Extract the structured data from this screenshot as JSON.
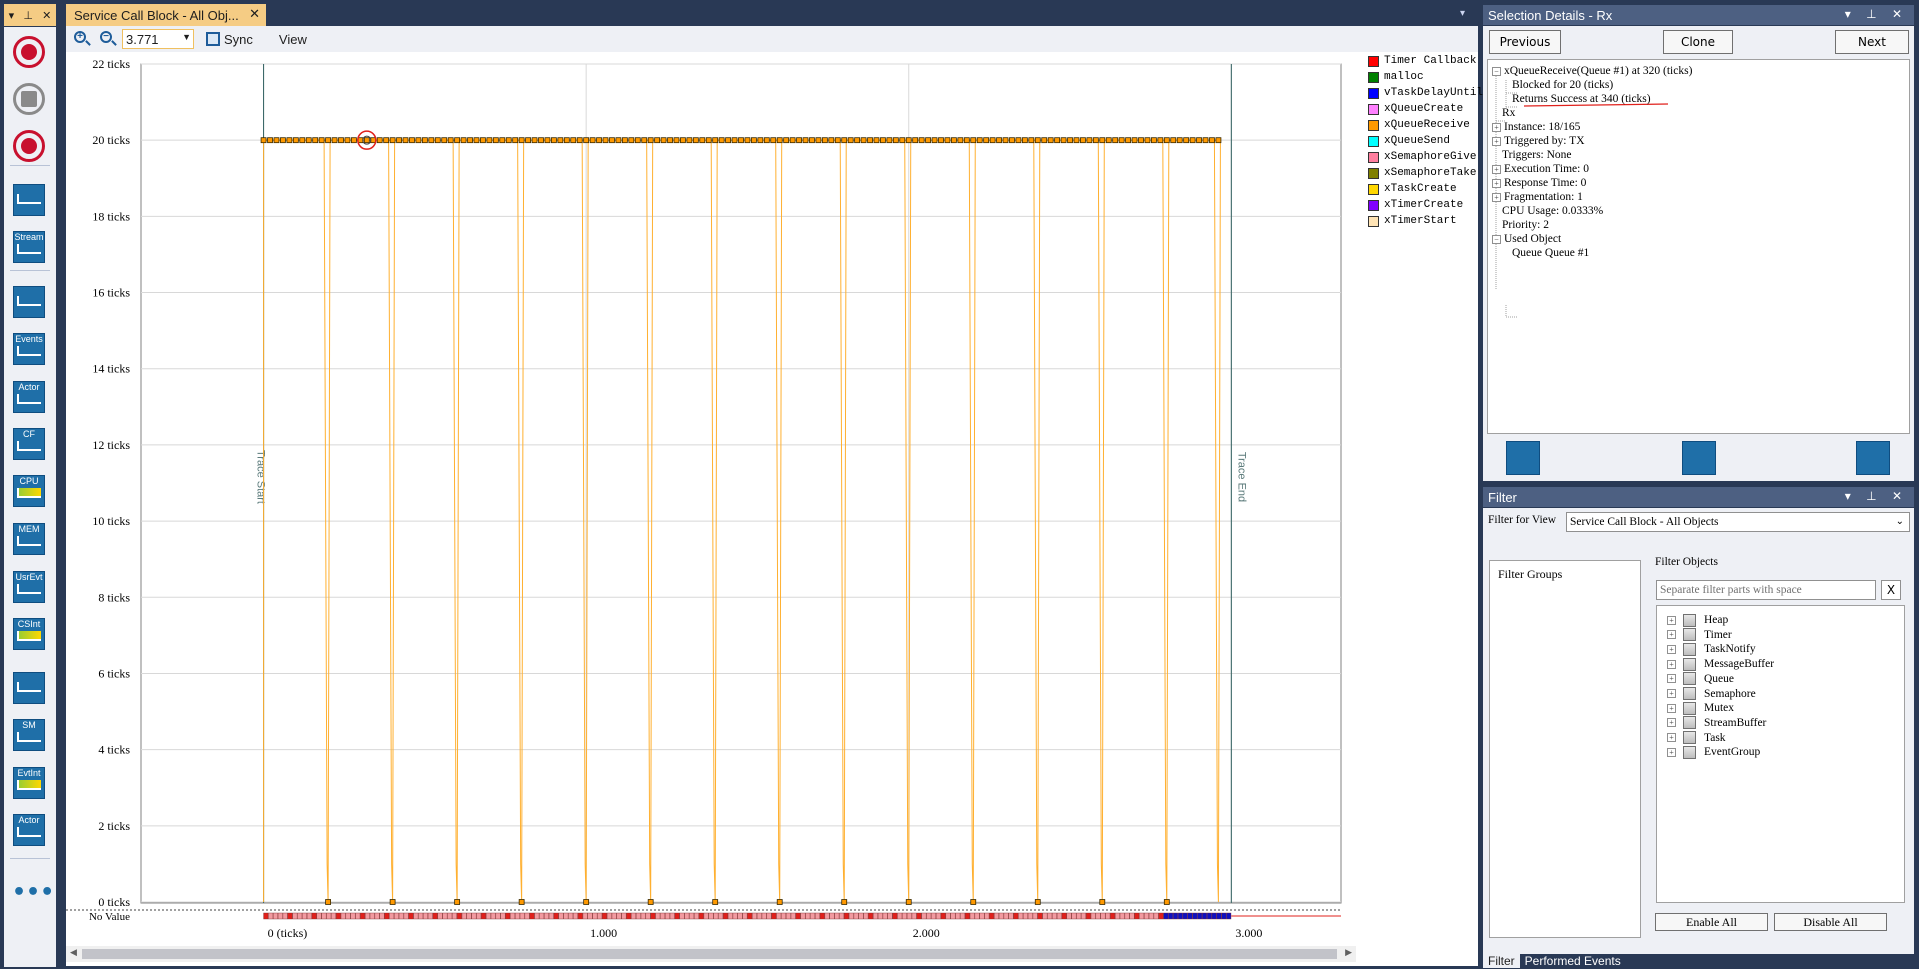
{
  "left_toolbar": {
    "header": [
      "▾",
      "⊥",
      "✕"
    ],
    "tiles": [
      {
        "label": "",
        "icon": "record-icon",
        "color": "#c8102e"
      },
      {
        "label": "",
        "icon": "stop-icon",
        "color": "#8a8a8a"
      },
      {
        "label": "",
        "icon": "snapshot-icon",
        "color": "#c8102e"
      },
      {
        "label": "",
        "icon": "dashboard-icon",
        "color": "#1f6fa8"
      },
      {
        "label": "Stream",
        "icon": "stream-icon",
        "color": "#1f6fa8"
      },
      {
        "label": "",
        "icon": "trace-view-icon",
        "color": "#1f6fa8"
      },
      {
        "label": "Events",
        "icon": "events-icon",
        "color": "#1f6fa8"
      },
      {
        "label": "Actor",
        "icon": "actor-icon",
        "color": "#1f6fa8"
      },
      {
        "label": "CF",
        "icon": "communication-flow-icon",
        "color": "#1f6fa8"
      },
      {
        "label": "CPU",
        "icon": "cpu-load-icon",
        "color": "#1f6fa8"
      },
      {
        "label": "MEM",
        "icon": "memory-icon",
        "color": "#1f6fa8"
      },
      {
        "label": "UsrEvt",
        "icon": "user-events-icon",
        "color": "#1f6fa8"
      },
      {
        "label": "CSInt",
        "icon": "context-switch-intensity-icon",
        "color": "#1f6fa8"
      },
      {
        "label": "",
        "icon": "object-history-icon",
        "color": "#1f6fa8"
      },
      {
        "label": "SM",
        "icon": "state-machine-icon",
        "color": "#1f6fa8"
      },
      {
        "label": "EvtInt",
        "icon": "event-intensity-icon",
        "color": "#1f6fa8"
      },
      {
        "label": "Actor",
        "icon": "actor-instances-icon",
        "color": "#1f6fa8"
      }
    ],
    "more": "•••"
  },
  "document": {
    "tab_title": "Service Call Block - All Obj...",
    "tab_close": "✕",
    "dropdown": "▾",
    "toolbar": {
      "zoom_value": "3.771",
      "sync_label": "Sync",
      "view_label": "View"
    }
  },
  "chart_data": {
    "type": "scatter",
    "y_ticks": [
      "22 ticks",
      "20 ticks",
      "18 ticks",
      "16 ticks",
      "14 ticks",
      "12 ticks",
      "10 ticks",
      "8 ticks",
      "6 ticks",
      "4 ticks",
      "2 ticks",
      "0 ticks"
    ],
    "y_extra_label": "No Value",
    "x_ticks": [
      "0 (ticks)",
      "1.000",
      "2.000",
      "3.000"
    ],
    "ylim": [
      0,
      22
    ],
    "xlim": [
      -380,
      3340
    ],
    "trace_start_label": "Trace Start",
    "trace_end_label": "Trace End",
    "trace_start": 0,
    "trace_end": 3000,
    "series": [
      {
        "name": "xQueueReceive",
        "color": "#ff9900",
        "y": 20,
        "x_from": 0,
        "x_to": 2960,
        "step": 20
      },
      {
        "name": "xQueueSend",
        "color": "#ff9900",
        "y": 0,
        "x": [
          200,
          400,
          600,
          800,
          1000,
          1200,
          1400,
          1600,
          1800,
          2000,
          2200,
          2400,
          2600,
          2800
        ]
      }
    ],
    "drop_lines_x": [
      0,
      200,
      400,
      600,
      800,
      1000,
      1200,
      1400,
      1600,
      1800,
      2000,
      2200,
      2400,
      2600,
      2800,
      2960
    ],
    "highlight_x": 320,
    "grid": true
  },
  "legend": [
    {
      "name": "Timer Callback",
      "color": "#ff0000"
    },
    {
      "name": "malloc",
      "color": "#008000"
    },
    {
      "name": "vTaskDelayUntil",
      "color": "#0000ff"
    },
    {
      "name": "xQueueCreate",
      "color": "#ff80ff"
    },
    {
      "name": "xQueueReceive",
      "color": "#ff9900"
    },
    {
      "name": "xQueueSend",
      "color": "#00ffff"
    },
    {
      "name": "xSemaphoreGive",
      "color": "#ff7f9f"
    },
    {
      "name": "xSemaphoreTake",
      "color": "#808000"
    },
    {
      "name": "xTaskCreate",
      "color": "#ffd700"
    },
    {
      "name": "xTimerCreate",
      "color": "#8000ff"
    },
    {
      "name": "xTimerStart",
      "color": "#ffe4b5"
    }
  ],
  "selection_details": {
    "title": "Selection Details - Rx",
    "controls": "▾ ⊥ ✕",
    "previous": "Previous",
    "clone": "Clone",
    "next": "Next",
    "tree": [
      {
        "text": "xQueueReceive(Queue #1) at 320 (ticks)",
        "indent": 0,
        "expander": "−"
      },
      {
        "text": "Blocked for 20 (ticks)",
        "indent": 2,
        "expander": ""
      },
      {
        "text": "Returns Success at 340 (ticks)",
        "indent": 2,
        "expander": ""
      },
      {
        "text": "Rx",
        "indent": 1,
        "expander": ""
      },
      {
        "text": "Instance: 18/165",
        "indent": 0,
        "expander": "+"
      },
      {
        "text": "Triggered by: TX",
        "indent": 0,
        "expander": "+"
      },
      {
        "text": "Triggers: None",
        "indent": 1,
        "expander": ""
      },
      {
        "text": "Execution Time: 0",
        "indent": 0,
        "expander": "+"
      },
      {
        "text": "Response Time: 0",
        "indent": 0,
        "expander": "+"
      },
      {
        "text": "Fragmentation: 1",
        "indent": 0,
        "expander": "+"
      },
      {
        "text": "CPU Usage: 0.0333%",
        "indent": 1,
        "expander": ""
      },
      {
        "text": "Priority: 2",
        "indent": 1,
        "expander": ""
      },
      {
        "text": "Used Object",
        "indent": 0,
        "expander": "−"
      },
      {
        "text": "Queue Queue #1",
        "indent": 2,
        "expander": ""
      }
    ]
  },
  "filter": {
    "title": "Filter",
    "controls": "▾ ⊥ ✕",
    "filter_for_view_label": "Filter for View",
    "view_value": "Service Call Block - All Objects",
    "filter_groups_label": "Filter Groups",
    "filter_objects_label": "Filter Objects",
    "search_placeholder": "Separate filter parts with space",
    "clear": "X",
    "objects": [
      "Heap",
      "Timer",
      "TaskNotify",
      "MessageBuffer",
      "Queue",
      "Semaphore",
      "Mutex",
      "StreamBuffer",
      "Task",
      "EventGroup"
    ],
    "enable_all": "Enable All",
    "disable_all": "Disable All"
  },
  "bottom_tabs": [
    "Filter",
    "Performed Events"
  ]
}
